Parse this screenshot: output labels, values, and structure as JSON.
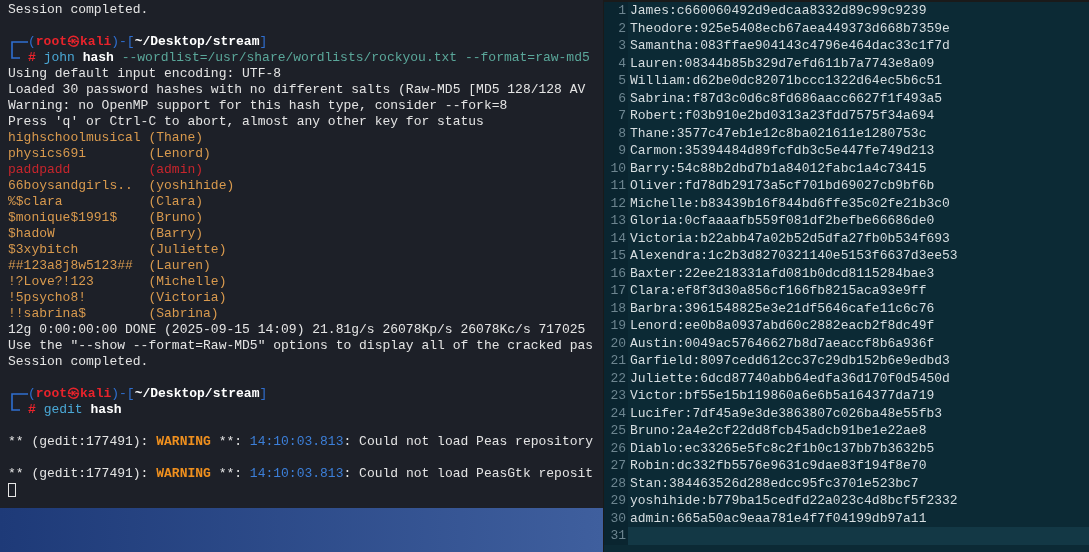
{
  "terminal": {
    "lines": [
      {
        "kind": "text",
        "text": "Session completed."
      },
      {
        "kind": "blank"
      },
      {
        "kind": "prompt",
        "brackets": [
          "(",
          ")-[",
          "]"
        ],
        "user": "root",
        "separator": "㉿",
        "host": "kali",
        "path": "~/Desktop/stream",
        "symbol": "#",
        "command": "john",
        "target": "hash",
        "args": "--wordlist=/usr/share/wordlists/rockyou.txt --format=raw-md5"
      },
      {
        "kind": "text",
        "text": "Using default input encoding: UTF-8"
      },
      {
        "kind": "text",
        "text": "Loaded 30 password hashes with no different salts (Raw-MD5 [MD5 128/128 AV"
      },
      {
        "kind": "text",
        "text": "Warning: no OpenMP support for this hash type, consider --fork=8"
      },
      {
        "kind": "text",
        "text": "Press 'q' or Ctrl-C to abort, almost any other key for status"
      },
      {
        "kind": "cracked",
        "password": "highschoolmusical",
        "user": "(Thane)",
        "color": "#d99a4e"
      },
      {
        "kind": "cracked",
        "password": "physics69i",
        "user": "(Lenord)",
        "color": "#d99a4e"
      },
      {
        "kind": "cracked",
        "password": "paddpadd",
        "user": "(admin)",
        "color": "#c8252c"
      },
      {
        "kind": "cracked",
        "password": "66boysandgirls..",
        "user": "(yoshihide)",
        "color": "#d99a4e"
      },
      {
        "kind": "cracked",
        "password": "%$clara",
        "user": "(Clara)",
        "color": "#d99a4e"
      },
      {
        "kind": "cracked",
        "password": "$monique$1991$",
        "user": "(Bruno)",
        "color": "#d99a4e"
      },
      {
        "kind": "cracked",
        "password": "$hadoW",
        "user": "(Barry)",
        "color": "#d99a4e"
      },
      {
        "kind": "cracked",
        "password": "$3xybitch",
        "user": "(Juliette)",
        "color": "#d99a4e"
      },
      {
        "kind": "cracked",
        "password": "##123a8j8w5123##",
        "user": "(Lauren)",
        "color": "#d99a4e"
      },
      {
        "kind": "cracked",
        "password": "!?Love?!123",
        "user": "(Michelle)",
        "color": "#d99a4e"
      },
      {
        "kind": "cracked",
        "password": "!5psycho8!",
        "user": "(Victoria)",
        "color": "#d99a4e"
      },
      {
        "kind": "cracked",
        "password": "!!sabrina$",
        "user": "(Sabrina)",
        "color": "#d99a4e"
      },
      {
        "kind": "text",
        "text": "12g 0:00:00:00 DONE (2025-09-15 14:09) 21.81g/s 26078Kp/s 26078Kc/s 717025"
      },
      {
        "kind": "text",
        "text": "Use the \"--show --format=Raw-MD5\" options to display all of the cracked pas"
      },
      {
        "kind": "text",
        "text": "Session completed."
      },
      {
        "kind": "blank"
      },
      {
        "kind": "prompt",
        "brackets": [
          "(",
          ")-[",
          "]"
        ],
        "user": "root",
        "separator": "㉿",
        "host": "kali",
        "path": "~/Desktop/stream",
        "symbol": "#",
        "command": "gedit",
        "target": "hash"
      },
      {
        "kind": "blank"
      },
      {
        "kind": "warning",
        "prefix": "** (gedit:177491): ",
        "level": "WARNING",
        "middle": " **: ",
        "time": "14:10:03.813",
        "message": ": Could not load Peas repository"
      },
      {
        "kind": "blank"
      },
      {
        "kind": "warning",
        "prefix": "** (gedit:177491): ",
        "level": "WARNING",
        "middle": " **: ",
        "time": "14:10:03.813",
        "message": ": Could not load PeasGtk reposit"
      },
      {
        "kind": "cursor"
      }
    ]
  },
  "editor": {
    "lines": [
      {
        "number": "1",
        "text": "James:c660060492d9edcaa8332d89c99c9239",
        "current": false
      },
      {
        "number": "2",
        "text": "Theodore:925e5408ecb67aea449373d668b7359e",
        "current": false
      },
      {
        "number": "3",
        "text": "Samantha:083ffae904143c4796e464dac33c1f7d",
        "current": false
      },
      {
        "number": "4",
        "text": "Lauren:08344b85b329d7efd611b7a7743e8a09",
        "current": false
      },
      {
        "number": "5",
        "text": "William:d62be0dc82071bccc1322d64ec5b6c51",
        "current": false
      },
      {
        "number": "6",
        "text": "Sabrina:f87d3c0d6c8fd686aacc6627f1f493a5",
        "current": false
      },
      {
        "number": "7",
        "text": "Robert:f03b910e2bd0313a23fdd7575f34a694",
        "current": false
      },
      {
        "number": "8",
        "text": "Thane:3577c47eb1e12c8ba021611e1280753c",
        "current": false
      },
      {
        "number": "9",
        "text": "Carmon:35394484d89fcfdb3c5e447fe749d213",
        "current": false
      },
      {
        "number": "10",
        "text": "Barry:54c88b2dbd7b1a84012fabc1a4c73415",
        "current": false
      },
      {
        "number": "11",
        "text": "Oliver:fd78db29173a5cf701bd69027cb9bf6b",
        "current": false
      },
      {
        "number": "12",
        "text": "Michelle:b83439b16f844bd6ffe35c02fe21b3c0",
        "current": false
      },
      {
        "number": "13",
        "text": "Gloria:0cfaaaafb559f081df2befbe66686de0",
        "current": false
      },
      {
        "number": "14",
        "text": "Victoria:b22abb47a02b52d5dfa27fb0b534f693",
        "current": false
      },
      {
        "number": "15",
        "text": "Alexendra:1c2b3d8270321140e5153f6637d3ee53",
        "current": false
      },
      {
        "number": "16",
        "text": "Baxter:22ee218331afd081b0dcd8115284bae3",
        "current": false
      },
      {
        "number": "17",
        "text": "Clara:ef8f3d30a856cf166fb8215aca93e9ff",
        "current": false
      },
      {
        "number": "18",
        "text": "Barbra:3961548825e3e21df5646cafe11c6c76",
        "current": false
      },
      {
        "number": "19",
        "text": "Lenord:ee0b8a0937abd60c2882eacb2f8dc49f",
        "current": false
      },
      {
        "number": "20",
        "text": "Austin:0049ac57646627b8d7aeaccf8b6a936f",
        "current": false
      },
      {
        "number": "21",
        "text": "Garfield:8097cedd612cc37c29db152b6e9edbd3",
        "current": false
      },
      {
        "number": "22",
        "text": "Juliette:6dcd87740abb64edfa36d170f0d5450d",
        "current": false
      },
      {
        "number": "23",
        "text": "Victor:bf55e15b119860a6e6b5a164377da719",
        "current": false
      },
      {
        "number": "24",
        "text": "Lucifer:7df45a9e3de3863807c026ba48e55fb3",
        "current": false
      },
      {
        "number": "25",
        "text": "Bruno:2a4e2cf22dd8fcb45adcb91be1e22ae8",
        "current": false
      },
      {
        "number": "26",
        "text": "Diablo:ec33265e5fc8c2f1b0c137bb7b3632b5",
        "current": false
      },
      {
        "number": "27",
        "text": "Robin:dc332fb5576e9631c9dae83f194f8e70",
        "current": false
      },
      {
        "number": "28",
        "text": "Stan:384463526d288edcc95fc3701e523bc7",
        "current": false
      },
      {
        "number": "29",
        "text": "yoshihide:b779ba15cedfd22a023c4d8bcf5f2332",
        "current": false
      },
      {
        "number": "30",
        "text": "admin:665a50ac9eaa781e4f7f04199db97a11",
        "current": false
      },
      {
        "number": "31",
        "current": true
      }
    ]
  }
}
